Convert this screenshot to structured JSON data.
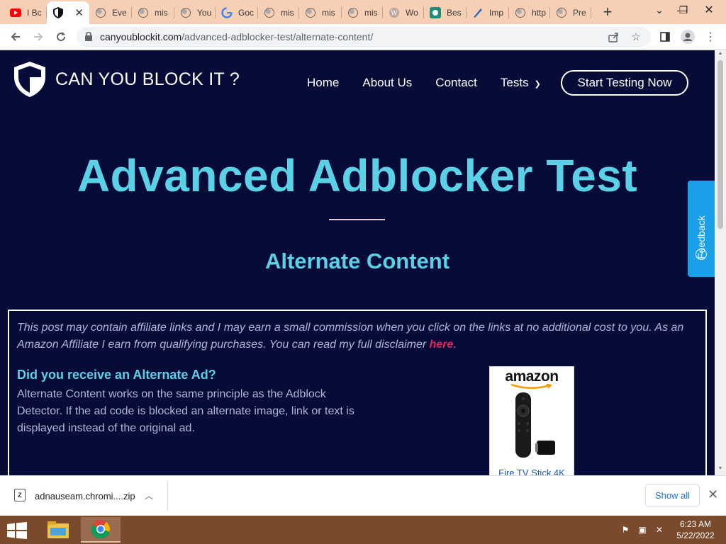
{
  "browser": {
    "tabs": [
      {
        "label": "I Bc",
        "icon": "youtube-icon"
      },
      {
        "label": "",
        "icon": "shield-icon",
        "active": true
      },
      {
        "label": "Eve",
        "icon": "globe-icon"
      },
      {
        "label": "mis",
        "icon": "globe-icon"
      },
      {
        "label": "You",
        "icon": "globe-icon"
      },
      {
        "label": "Goc",
        "icon": "google-icon"
      },
      {
        "label": "mis",
        "icon": "globe-icon"
      },
      {
        "label": "mis",
        "icon": "globe-icon"
      },
      {
        "label": "mis",
        "icon": "globe-icon"
      },
      {
        "label": "Wo",
        "icon": "wordpress-icon"
      },
      {
        "label": "Bes",
        "icon": "app-icon"
      },
      {
        "label": "Imp",
        "icon": "pen-icon"
      },
      {
        "label": "http",
        "icon": "globe-icon"
      },
      {
        "label": "Pre",
        "icon": "globe-icon"
      }
    ],
    "new_tab": "+",
    "url_domain": "canyoublockit.com",
    "url_path": "/advanced-adblocker-test/alternate-content/"
  },
  "site": {
    "brand": "CAN YOU BLOCK IT ?",
    "nav": [
      "Home",
      "About Us",
      "Contact",
      "Tests"
    ],
    "cta": "Start Testing Now",
    "title": "Advanced Adblocker Test",
    "subtitle": "Alternate Content",
    "feedback": "Feedback",
    "disclaimer_text": "This post may contain affiliate links and I may earn a small commission when you click on the links at no additional cost to you. As an Amazon Affiliate I earn from qualifying purchases. You can read my full disclaimer ",
    "disclaimer_link": "here",
    "disclaimer_end": ".",
    "question": "Did you receive an Alternate Ad?",
    "body": "Alternate Content works on the same principle as the Adblock Detector. If the ad code is blocked an alternate image, link or text is displayed instead of the original ad.",
    "ad": {
      "brand": "amazon",
      "product": "Fire TV Stick 4K"
    }
  },
  "downloads": {
    "file": "adnauseam.chromi....zip",
    "show_all": "Show all"
  },
  "taskbar": {
    "time": "6:23 AM",
    "date": "5/22/2022"
  },
  "colors": {
    "page_bg": "#060b38",
    "accent": "#5ad1e6",
    "link": "#e0245e",
    "feedback": "#1aa0e8",
    "tabstrip": "#f6cfb4",
    "taskbar": "#7a4a2c"
  }
}
